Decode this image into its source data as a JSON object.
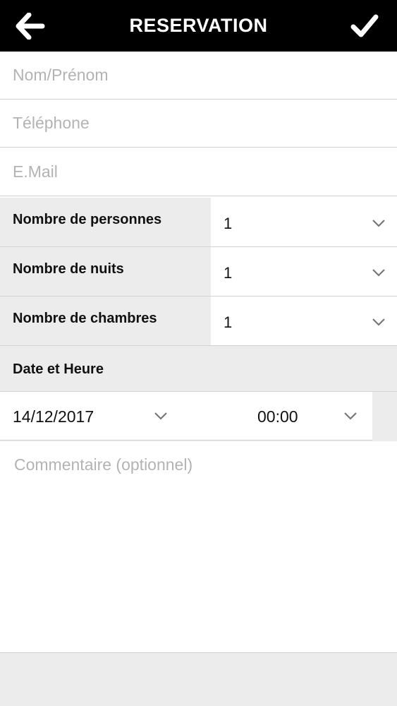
{
  "header": {
    "title": "RESERVATION",
    "back_icon": "arrow-left-icon",
    "confirm_icon": "checkmark-icon",
    "background": "#000000",
    "text_color": "#ffffff"
  },
  "fields": {
    "name_placeholder": "Nom/Prénom",
    "phone_placeholder": "Téléphone",
    "email_placeholder": "E.Mail"
  },
  "selects": {
    "persons": {
      "label": "Nombre de personnes",
      "value": "1"
    },
    "nights": {
      "label": "Nombre de nuits",
      "value": "1"
    },
    "rooms": {
      "label": "Nombre de chambres",
      "value": "1"
    }
  },
  "datetime": {
    "section_label": "Date et Heure",
    "date": "14/12/2017",
    "time": "00:00"
  },
  "comment": {
    "placeholder": "Commentaire (optionnel)"
  },
  "colors": {
    "label_background": "#ececec",
    "divider": "#cfcfcf",
    "placeholder": "#b3b3b3"
  }
}
